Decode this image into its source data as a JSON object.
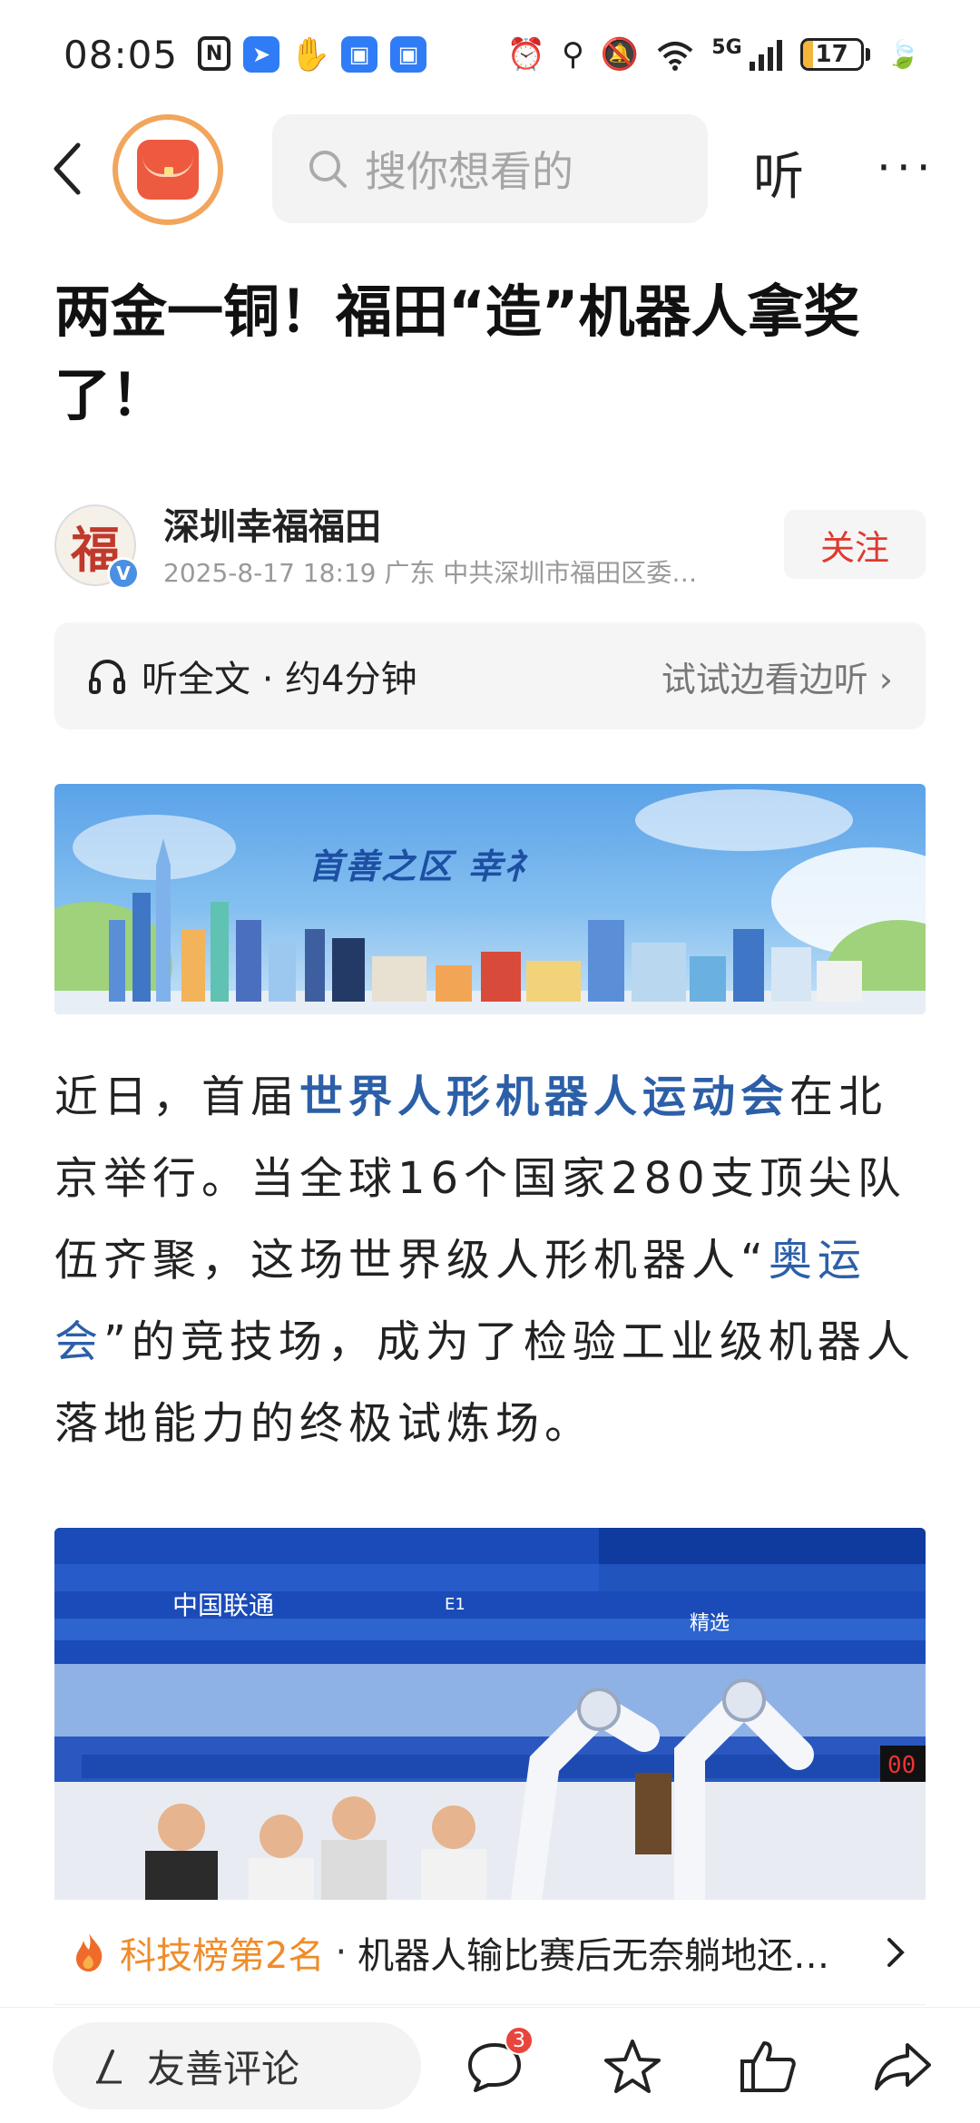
{
  "status_bar": {
    "time": "08:05",
    "network": "5G",
    "battery_level": "17",
    "battery_fraction": 0.17
  },
  "nav": {
    "search_placeholder": "搜你想看的",
    "listen_label": "听",
    "more_label": "···"
  },
  "article": {
    "title": "两金一铜！福田“造”机器人拿奖了！",
    "author": {
      "name": "深圳幸福福田",
      "avatar_glyph": "福",
      "verified_mark": "V",
      "meta": "2025-8-17  18:19  广东  中共深圳市福田区委…",
      "follow_label": "关注"
    },
    "listen_bar": {
      "label": "听全文 · 约4分钟",
      "try_label": "试试边看边听 ›"
    },
    "banner_text": "首善之区   幸礻",
    "paragraph": {
      "p1": "近日，首届",
      "link1": "世界人形机器人运动会",
      "p2": "在北京举行。当全球16个国家280支顶尖队伍齐聚，这场世界级人形机器人“",
      "link2": "奥运会",
      "p3": "”的竞技场，成为了检验工业级机器人落地能力的终极试炼场。"
    },
    "photo_signs": {
      "sponsor": "中国联通",
      "section": "E1",
      "selection": "精选",
      "timer": "00"
    }
  },
  "trending": {
    "rank": "科技榜第2名",
    "separator": "·",
    "title": "机器人输比赛后无奈躺地还…"
  },
  "bottom_bar": {
    "comment_placeholder": "友善评论",
    "comment_count": "3"
  },
  "colors": {
    "accent_red": "#e0392f",
    "link_blue": "#2c5fa8",
    "trend_orange": "#ef8c2a",
    "badge_red": "#e8453c"
  }
}
